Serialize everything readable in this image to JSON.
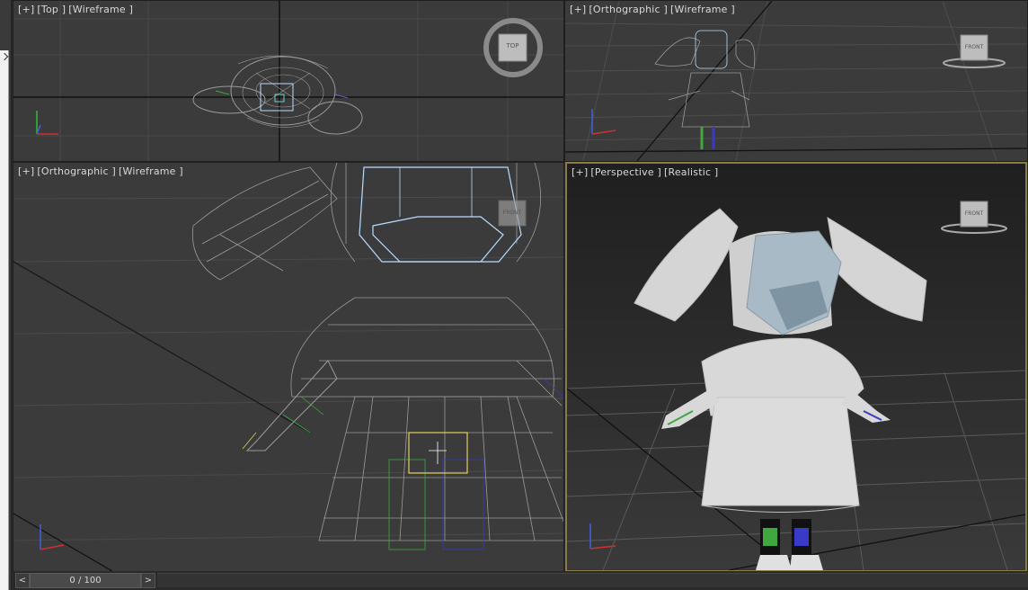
{
  "viewports": {
    "top": {
      "plus": "[+]",
      "view": "[Top ]",
      "shading": "[Wireframe ]",
      "cube_label": "TOP"
    },
    "front_small": {
      "plus": "[+]",
      "view": "[Orthographic ]",
      "shading": "[Wireframe ]",
      "cube_label": "FRONT"
    },
    "front_large": {
      "plus": "[+]",
      "view": "[Orthographic ]",
      "shading": "[Wireframe ]",
      "cube_label": "FRONT"
    },
    "perspective": {
      "plus": "[+]",
      "view": "[Perspective ]",
      "shading": "[Realistic ]",
      "cube_label": "FRONT"
    }
  },
  "axes": {
    "x": "x",
    "y": "y",
    "z": "z"
  },
  "timeline": {
    "prev": "<",
    "next": ">",
    "frame_display": "0 / 100"
  },
  "colors": {
    "viewport_bg": "#3b3b3b",
    "perspective_bg": "#2e2e2e",
    "active_border": "#8a7a45",
    "wire_grey": "#9a9a9a",
    "wire_select": "#b8dcff",
    "wire_green": "#3fa83f",
    "wire_blue": "#3a3ac8",
    "axis_x": "#d03030",
    "axis_y": "#30c030",
    "axis_z": "#4060e0"
  },
  "icons": [
    "viewcube-ring-icon",
    "axis-tripod-icon",
    "viewcube-front-icon"
  ]
}
